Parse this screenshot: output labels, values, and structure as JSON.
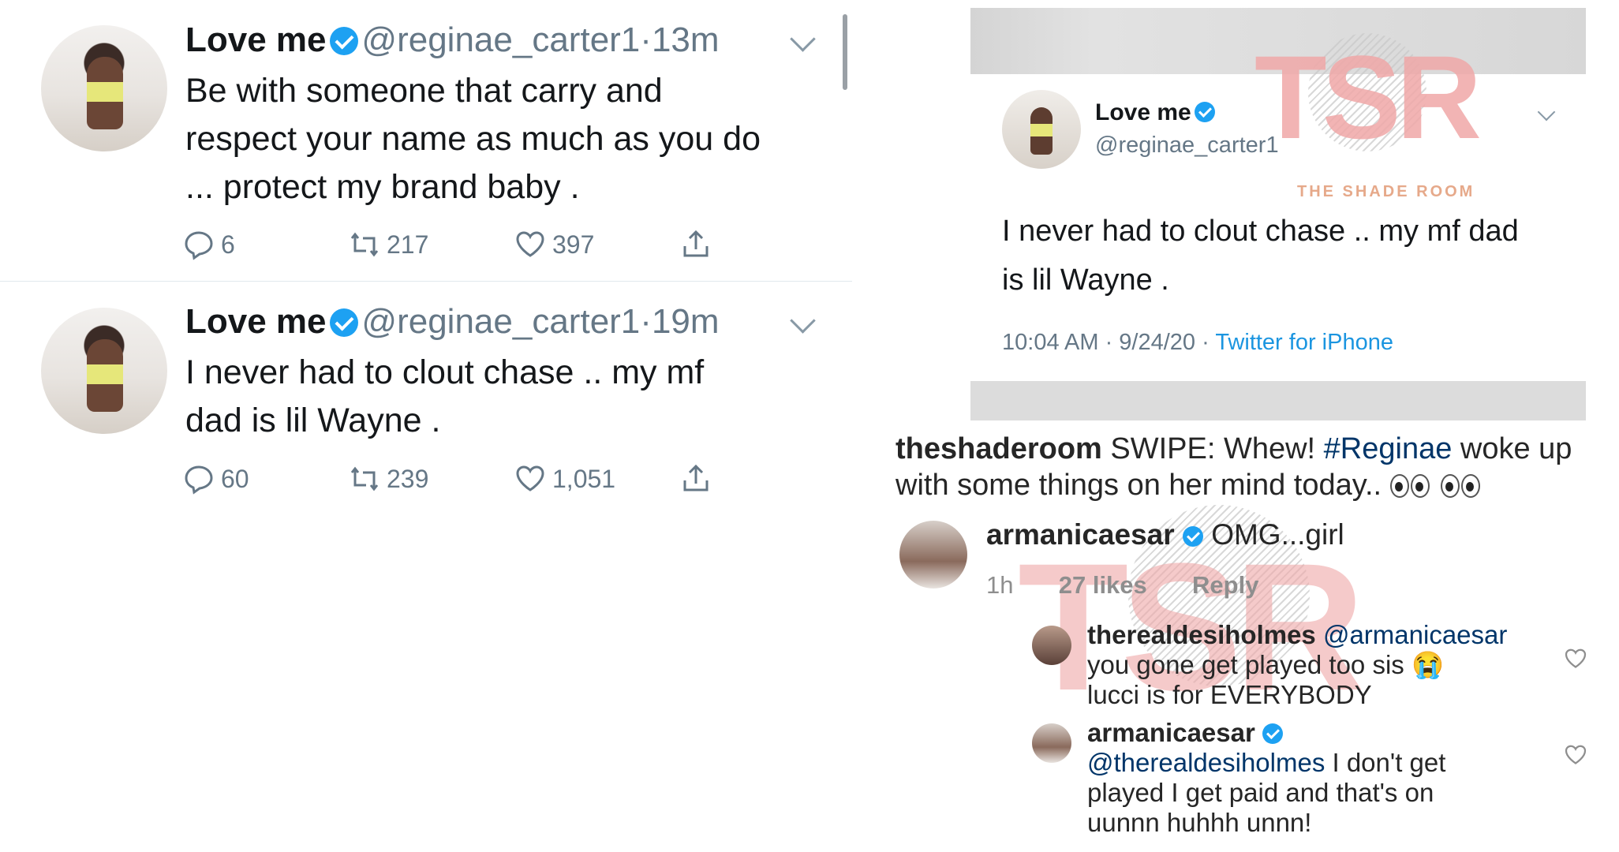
{
  "twitter": {
    "tweets": [
      {
        "name": "Love me",
        "handle": "@reginae_carter1",
        "dot": "·",
        "time": "13m",
        "text_lines": [
          "Be with someone that carry and",
          "respect your name as much as you do",
          "... protect my brand baby ."
        ],
        "replies": "6",
        "retweets": "217",
        "likes": "397"
      },
      {
        "name": "Love me",
        "handle": "@reginae_carter1",
        "dot": "·",
        "time": "19m",
        "text_lines": [
          "I never had to clout chase .. my mf",
          "dad is  lil Wayne ."
        ],
        "replies": "60",
        "retweets": "239",
        "likes": "1,051"
      }
    ],
    "icons": [
      "reply-icon",
      "retweet-icon",
      "like-icon",
      "share-icon",
      "chevron-down-icon",
      "verified-icon"
    ]
  },
  "embedded_tweet": {
    "name": "Love me",
    "handle": "@reginae_carter1",
    "text_lines": [
      "I never had to clout chase .. my mf dad",
      "is  lil Wayne ."
    ],
    "timestamp": "10:04 AM · 9/24/20 · ",
    "source": "Twitter for iPhone",
    "watermark_logo": "TSR",
    "watermark_text": "THE SHADE ROOM"
  },
  "instagram": {
    "caption": {
      "user": "theshaderoom",
      "text_before": " SWIPE: Whew! ",
      "hashtag": "#Reginae",
      "text_after": " woke up",
      "line2": "with some things on her mind today.. "
    },
    "comment": {
      "user": "armanicaesar",
      "text": "OMG...girl",
      "time": "1h",
      "likes": "27 likes",
      "reply": "Reply"
    },
    "replies": [
      {
        "user": "therealdesiholmes",
        "mention": "@armanicaesar",
        "lines": [
          "you gone get played too sis ",
          "lucci is for EVERYBODY"
        ],
        "emoji": "😭"
      },
      {
        "user": "armanicaesar",
        "mention": "@therealdesiholmes",
        "lines": [
          " I don't get",
          "played I get paid and that's on",
          "uunnn huhhh unnn!"
        ]
      }
    ],
    "watermark_logo": "TSR"
  },
  "colors": {
    "twitter_blue": "#1da1f2",
    "twitter_gray": "#657786",
    "tsr_pink": "#f0a8a8",
    "ig_link": "#003569"
  }
}
